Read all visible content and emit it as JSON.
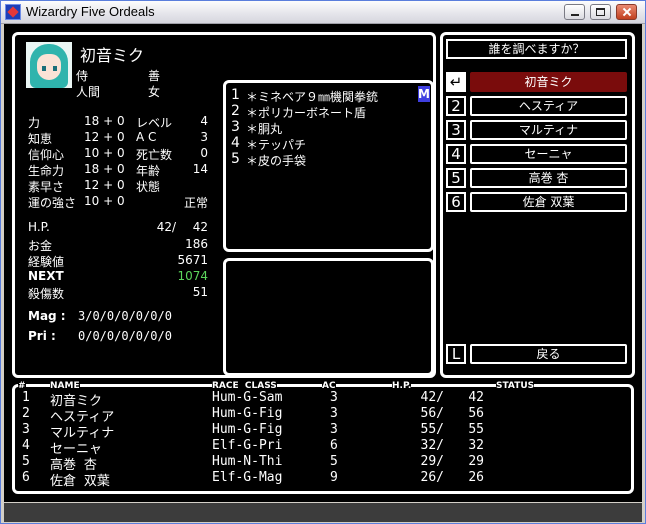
{
  "window": {
    "title": "Wizardry Five Ordeals"
  },
  "character": {
    "name": "初音ミク",
    "class": "侍",
    "alignment": "善",
    "race": "人間",
    "gender": "女",
    "attrs": [
      {
        "label": "力",
        "value": "18 + 0",
        "label2": "レベル",
        "value2": "4"
      },
      {
        "label": "知恵",
        "value": "12 + 0",
        "label2": "A C",
        "value2": "3"
      },
      {
        "label": "信仰心",
        "value": "10 + 0",
        "label2": "死亡数",
        "value2": "0"
      },
      {
        "label": "生命力",
        "value": "18 + 0",
        "label2": "年齢",
        "value2": "14"
      },
      {
        "label": "素早さ",
        "value": "12 + 0",
        "label2": "状態",
        "value2": ""
      },
      {
        "label": "運の強さ",
        "value": "10 + 0",
        "label2": "",
        "value2": "正常"
      }
    ],
    "hp_label": "H.P.",
    "hp_value": "42/",
    "hp_max": "42",
    "gold_label": "お金",
    "gold": "186",
    "exp_label": "経験値",
    "exp": "5671",
    "next_label": "NEXT",
    "next": "1074",
    "kills_label": "殺傷数",
    "kills": "51",
    "mag_label": "Mag :",
    "mag": "3/0/0/0/0/0/0",
    "pri_label": "Pri :",
    "pri": "0/0/0/0/0/0/0",
    "next_color": "#5cd65c"
  },
  "equipment": [
    {
      "num": "1",
      "name": "＊ミネベア９㎜機関拳銃"
    },
    {
      "num": "2",
      "name": "＊ポリカーボネート盾"
    },
    {
      "num": "3",
      "name": "＊胴丸"
    },
    {
      "num": "4",
      "name": "＊テッパチ"
    },
    {
      "num": "5",
      "name": "＊皮の手袋"
    }
  ],
  "equip_marker": "M",
  "menu": {
    "question": "誰を調べますか？",
    "selected_color": "#7a0c0c",
    "items": [
      {
        "key": "↵",
        "name": "初音ミク"
      },
      {
        "key": "2",
        "name": "ヘスティア"
      },
      {
        "key": "3",
        "name": "マルティナ"
      },
      {
        "key": "4",
        "name": "セーニャ"
      },
      {
        "key": "5",
        "name": "高巻 杏"
      },
      {
        "key": "6",
        "name": "佐倉 双葉"
      }
    ],
    "back_key": "L",
    "back": "戻る"
  },
  "party": {
    "headers": {
      "num": "#",
      "name": "NAME",
      "race_class": "RACE  CLASS",
      "ac": "AC",
      "hp": "H.P.",
      "status": "STATUS"
    },
    "rows": [
      {
        "num": "1",
        "name": "初音ミク",
        "rc": "Hum-G-Sam",
        "ac": "3",
        "hp": "42/",
        "hpmax": "42"
      },
      {
        "num": "2",
        "name": "ヘスティア",
        "rc": "Hum-G-Fig",
        "ac": "3",
        "hp": "56/",
        "hpmax": "56"
      },
      {
        "num": "3",
        "name": "マルティナ",
        "rc": "Hum-G-Fig",
        "ac": "3",
        "hp": "55/",
        "hpmax": "55"
      },
      {
        "num": "4",
        "name": "セーニャ",
        "rc": "Elf-G-Pri",
        "ac": "6",
        "hp": "32/",
        "hpmax": "32"
      },
      {
        "num": "5",
        "name": "高巻 杏",
        "rc": "Hum-N-Thi",
        "ac": "5",
        "hp": "29/",
        "hpmax": "29"
      },
      {
        "num": "6",
        "name": "佐倉 双葉",
        "rc": "Elf-G-Mag",
        "ac": "9",
        "hp": "26/",
        "hpmax": "26"
      }
    ]
  }
}
